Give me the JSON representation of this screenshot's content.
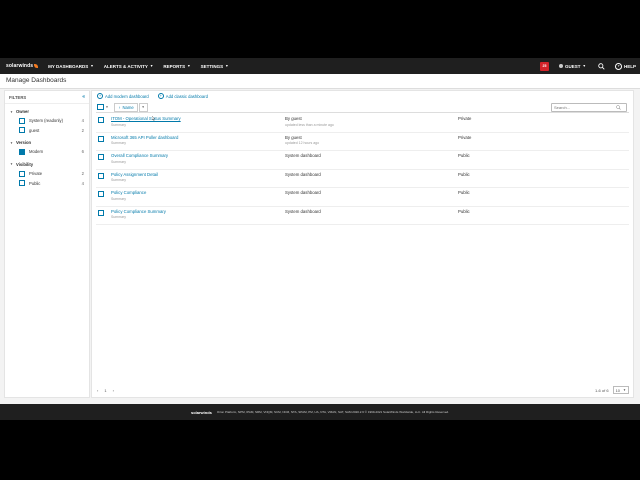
{
  "topnav": {
    "logo": "solarwinds",
    "items": [
      {
        "label": "MY DASHBOARDS"
      },
      {
        "label": "ALERTS & ACTIVITY"
      },
      {
        "label": "REPORTS"
      },
      {
        "label": "SETTINGS"
      }
    ],
    "alert_count": "25",
    "user": "GUEST",
    "help": "HELP"
  },
  "page": {
    "title": "Manage Dashboards"
  },
  "filters": {
    "header": "FILTERS",
    "collapse_icon": "«",
    "groups": [
      {
        "title": "Owner",
        "items": [
          {
            "label": "System (readonly)",
            "count": "4",
            "checked": false
          },
          {
            "label": "guest",
            "count": "2",
            "checked": false
          }
        ]
      },
      {
        "title": "Version",
        "items": [
          {
            "label": "Modern",
            "count": "6",
            "checked": true
          }
        ]
      },
      {
        "title": "Visibility",
        "items": [
          {
            "label": "Private",
            "count": "2",
            "checked": false
          },
          {
            "label": "Public",
            "count": "4",
            "checked": false
          }
        ]
      }
    ]
  },
  "main": {
    "add_modern": "Add modern dashboard",
    "add_classic": "Add classic dashboard",
    "sort_label": "Name",
    "search_placeholder": "Search...",
    "rows": [
      {
        "name": "ITOM - Operational Status Summary",
        "sub": "Summary",
        "owner": "By guest",
        "updated": "updated less than a minute ago",
        "visibility": "Private",
        "hover": true
      },
      {
        "name": "Microsoft 365 API Poller dashboard",
        "sub": "Summary",
        "owner": "By guest",
        "updated": "updated 12 hours ago",
        "visibility": "Private",
        "hover": false
      },
      {
        "name": "Overall Compliance Summary",
        "sub": "Summary",
        "owner": "System dashboard",
        "updated": "",
        "visibility": "Public",
        "hover": false
      },
      {
        "name": "Policy Assignment Detail",
        "sub": "Summary",
        "owner": "System dashboard",
        "updated": "",
        "visibility": "Public",
        "hover": false
      },
      {
        "name": "Policy Compliance",
        "sub": "Summary",
        "owner": "System dashboard",
        "updated": "",
        "visibility": "Public",
        "hover": false
      },
      {
        "name": "Policy Compliance Summary",
        "sub": "Summary",
        "owner": "System dashboard",
        "updated": "",
        "visibility": "Public",
        "hover": false
      }
    ],
    "pager": {
      "prev": "‹",
      "page": "1",
      "next": "›",
      "range": "1-6 of 6",
      "page_size": "10"
    }
  },
  "footer": {
    "logo": "solarwinds",
    "text": "Orion Platform, NPM, IPAM, SRM, VNQM, SCM, NCM, NTA, SPAM, PM, UA, NTA, VMAN, SAT, SAM 2020.2.6 © 1999-2021 SolarWinds Worldwide, LLC. All Rights Reserved."
  }
}
